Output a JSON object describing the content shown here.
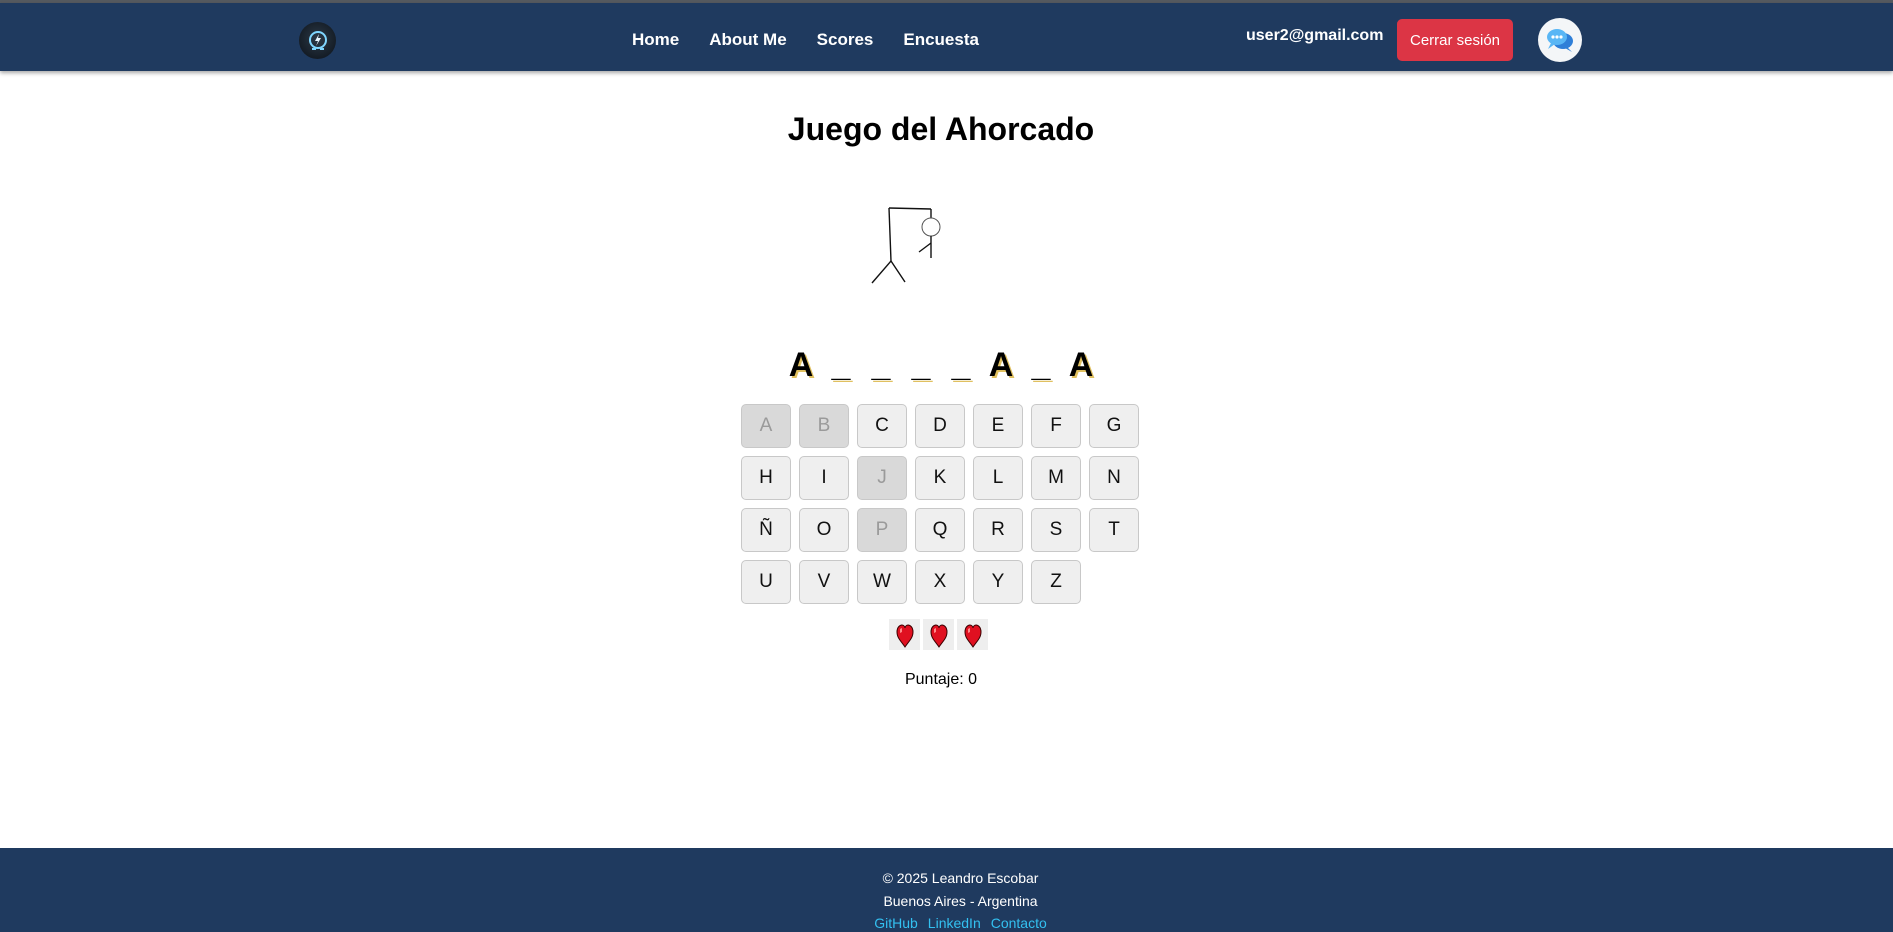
{
  "nav": {
    "links": [
      "Home",
      "About Me",
      "Scores",
      "Encuesta"
    ],
    "user_email": "user2@gmail.com",
    "logout_label": "Cerrar sesión"
  },
  "game": {
    "title": "Juego del Ahorcado",
    "word_display": [
      "A",
      "_",
      "_",
      "_",
      "_",
      "A",
      "_",
      "A"
    ],
    "keyboard": [
      [
        "A",
        "B",
        "C",
        "D",
        "E",
        "F",
        "G"
      ],
      [
        "H",
        "I",
        "J",
        "K",
        "L",
        "M",
        "N"
      ],
      [
        "Ñ",
        "O",
        "P",
        "Q",
        "R",
        "S",
        "T"
      ],
      [
        "U",
        "V",
        "W",
        "X",
        "Y",
        "Z"
      ]
    ],
    "used_letters": [
      "A",
      "B",
      "J",
      "P"
    ],
    "lives_remaining": 3,
    "score_text": "Puntaje: 0"
  },
  "footer": {
    "copyright": "© 2025 Leandro Escobar",
    "location": "Buenos Aires - Argentina",
    "links": [
      "GitHub",
      "LinkedIn",
      "Contacto"
    ]
  },
  "colors": {
    "header_bg": "#1f3a5f",
    "logout_bg": "#dc3545",
    "footer_link": "#33c0f0",
    "heart": "#e01020"
  }
}
